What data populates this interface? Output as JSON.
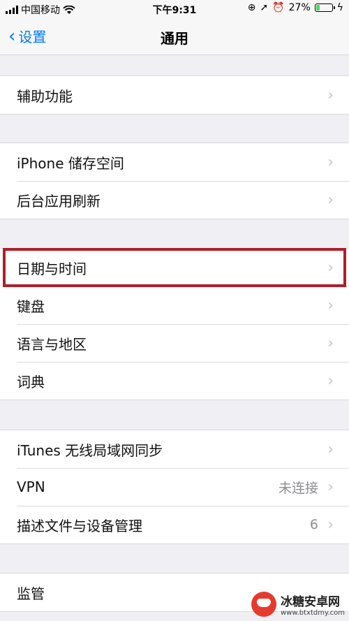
{
  "status_bar": {
    "carrier": "中国移动",
    "time": "下午9:31",
    "battery_percent": "27%",
    "battery_level": 0.27,
    "icons": [
      "signal-icon",
      "wifi-icon",
      "rotation-lock-icon",
      "location-icon",
      "alarm-icon",
      "battery-icon",
      "charging-icon"
    ]
  },
  "nav": {
    "back_label": "设置",
    "title": "通用"
  },
  "groups": [
    {
      "cells": [
        {
          "label": "辅助功能",
          "value": ""
        }
      ]
    },
    {
      "cells": [
        {
          "label": "iPhone 储存空间",
          "value": ""
        },
        {
          "label": "后台应用刷新",
          "value": ""
        }
      ]
    },
    {
      "cells": [
        {
          "label": "日期与时间",
          "value": ""
        },
        {
          "label": "键盘",
          "value": ""
        },
        {
          "label": "语言与地区",
          "value": ""
        },
        {
          "label": "词典",
          "value": ""
        }
      ]
    },
    {
      "cells": [
        {
          "label": "iTunes 无线局域网同步",
          "value": ""
        },
        {
          "label": "VPN",
          "value": "未连接"
        },
        {
          "label": "描述文件与设备管理",
          "value": "6"
        }
      ]
    },
    {
      "cells": [
        {
          "label": "监管",
          "value": ""
        }
      ]
    }
  ],
  "watermark": {
    "name": "冰糖安卓网",
    "url": "www.btxtdmy.com"
  },
  "colors": {
    "accent": "#007aff",
    "highlight": "#b01e2a",
    "background": "#efeff4"
  }
}
